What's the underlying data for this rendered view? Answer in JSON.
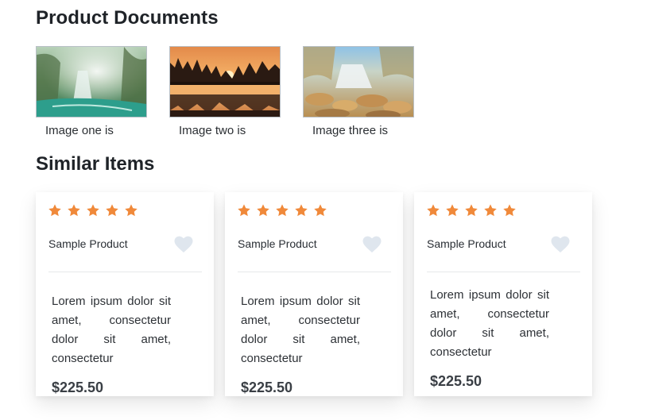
{
  "page": {
    "title": "Product Documents",
    "similar_title": "Similar Items"
  },
  "documents": [
    {
      "caption": "Image one is",
      "scene": "waterfall-forest-thumbnail"
    },
    {
      "caption": "Image two is",
      "scene": "sunset-lake-thumbnail"
    },
    {
      "caption": "Image three is",
      "scene": "autumn-waterfall-thumbnail"
    }
  ],
  "similar_items": [
    {
      "rating": 5,
      "max_rating": 5,
      "name": "Sample Product",
      "description": "Lorem ipsum dolor sit amet, consectetur dolor sit amet, consectetur",
      "price": "$225.50"
    },
    {
      "rating": 5,
      "max_rating": 5,
      "name": "Sample Product",
      "description": "Lorem ipsum dolor sit amet, consectetur dolor sit amet, consectetur",
      "price": "$225.50"
    },
    {
      "rating": 5,
      "max_rating": 5,
      "name": "Sample Product",
      "description": "Lorem ipsum dolor sit amet, consectetur dolor sit amet, consectetur",
      "price": "$225.50"
    }
  ],
  "colors": {
    "star": "#f0893a",
    "heart": "#dfe6ee",
    "heading": "#1f2328"
  },
  "icons": {
    "star": "star-icon",
    "favorite": "heart-icon"
  }
}
